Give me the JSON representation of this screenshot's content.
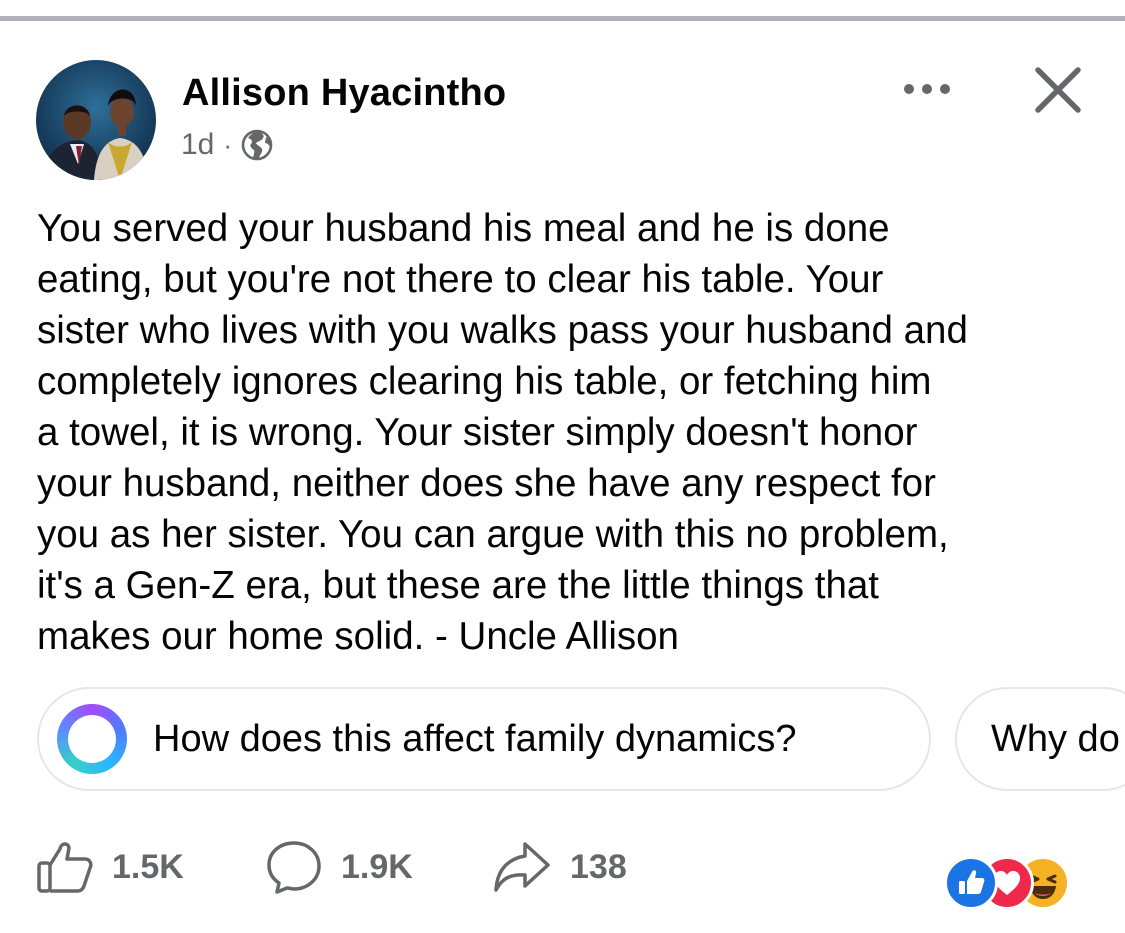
{
  "post": {
    "author": "Allison Hyacintho",
    "time": "1d",
    "separator": "·",
    "privacy_icon": "globe-icon",
    "text_lines": [
      "You served your husband his meal and he is done",
      "eating, but you're not there to clear his table. Your",
      "sister who lives with you walks pass your husband and",
      "completely ignores clearing his table, or fetching him",
      "a towel, it is wrong. Your sister simply doesn't honor",
      "your husband, neither does she have any respect for",
      "you as her sister. You can argue with this no problem,",
      "it's a Gen-Z era, but these are the little things that",
      "makes our home solid. - Uncle Allison"
    ]
  },
  "header_actions": {
    "more_icon": "more-options-icon",
    "close_icon": "close-icon"
  },
  "suggestions": [
    {
      "label": "How does this affect family dynamics?",
      "icon": "meta-ai-icon"
    },
    {
      "label": "Why do",
      "icon": ""
    }
  ],
  "stats": {
    "likes": "1.5K",
    "comments": "1.9K",
    "shares": "138"
  },
  "reactions": [
    "like",
    "love",
    "haha"
  ],
  "colors": {
    "text": "#050505",
    "secondary": "#65676b",
    "like_blue": "#1b74e4",
    "love_red": "#f0284a",
    "haha_yellow": "#f7b125"
  }
}
